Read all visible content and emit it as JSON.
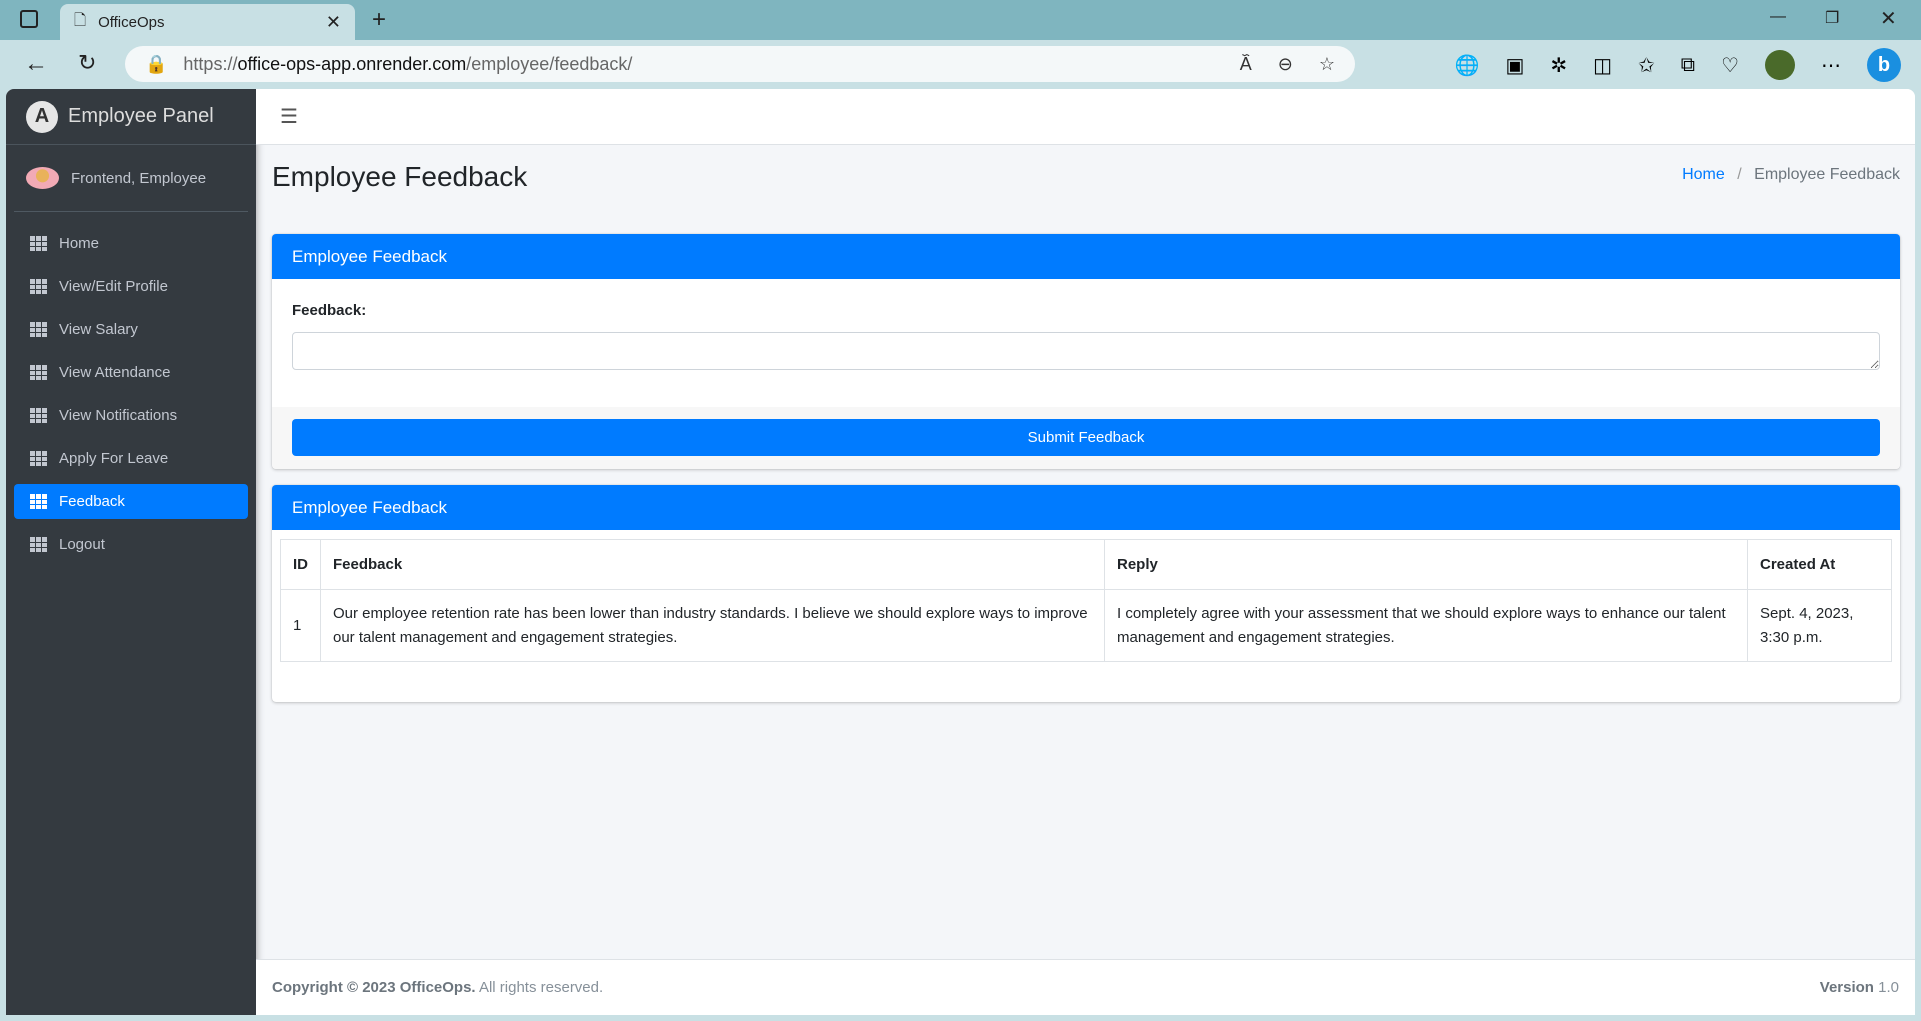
{
  "browser": {
    "tab_title": "OfficeOps",
    "url_scheme": "https://",
    "url_host": "office-ops-app.onrender.com",
    "url_path": "/employee/feedback/"
  },
  "sidebar": {
    "brand": "Employee Panel",
    "user": "Frontend, Employee",
    "items": [
      {
        "label": "Home"
      },
      {
        "label": "View/Edit Profile"
      },
      {
        "label": "View Salary"
      },
      {
        "label": "View Attendance"
      },
      {
        "label": "View Notifications"
      },
      {
        "label": "Apply For Leave"
      },
      {
        "label": "Feedback",
        "active": true
      },
      {
        "label": "Logout"
      }
    ]
  },
  "header": {
    "title": "Employee Feedback",
    "breadcrumb_home": "Home",
    "breadcrumb_sep": "/",
    "breadcrumb_current": "Employee Feedback"
  },
  "form": {
    "card_title": "Employee Feedback",
    "label": "Feedback:",
    "value": "",
    "submit": "Submit Feedback"
  },
  "list": {
    "card_title": "Employee Feedback",
    "columns": [
      "ID",
      "Feedback",
      "Reply",
      "Created At"
    ],
    "rows": [
      [
        "1",
        "Our employee retention rate has been lower than industry standards. I believe we should explore ways to improve our talent management and engagement strategies.",
        "I completely agree with your assessment that we should explore ways to enhance our talent management and engagement strategies.",
        "Sept. 4, 2023, 3:30 p.m."
      ]
    ]
  },
  "footer": {
    "copyright_prefix": "Copyright © 2023 OfficeOps.",
    "rights": " All rights reserved.",
    "version_label": "Version",
    "version": "1.0"
  },
  "colors": {
    "accent": "#007bff",
    "sidebar": "#343a40"
  }
}
